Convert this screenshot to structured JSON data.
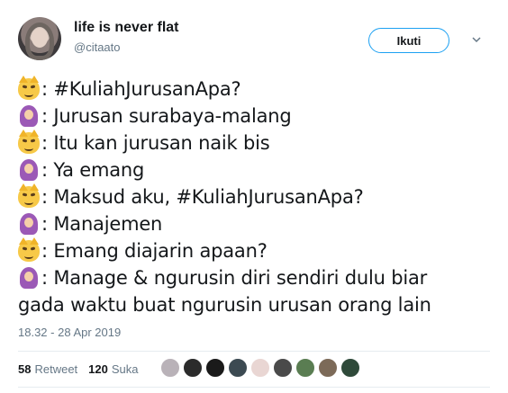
{
  "user": {
    "name": "life is never flat",
    "handle": "@citaato",
    "avatar_icon": "profile-photo"
  },
  "follow_button": {
    "label": "Ikuti"
  },
  "menu_icon": "chevron-down-icon",
  "lines": [
    {
      "speaker": "cat-emoji",
      "text": ": #KuliahJurusanApa?"
    },
    {
      "speaker": "woman-headscarf-emoji",
      "text": ": Jurusan surabaya-malang"
    },
    {
      "speaker": "cat-emoji",
      "text": ": Itu kan jurusan naik bis"
    },
    {
      "speaker": "woman-headscarf-emoji",
      "text": ": Ya emang"
    },
    {
      "speaker": "cat-emoji",
      "text": ": Maksud aku, #KuliahJurusanApa?"
    },
    {
      "speaker": "woman-headscarf-emoji",
      "text": ": Manajemen"
    },
    {
      "speaker": "cat-emoji",
      "text": ": Emang diajarin apaan?"
    },
    {
      "speaker": "woman-headscarf-emoji",
      "text": ": Manage & ngurusin diri sendiri dulu biar"
    },
    {
      "speaker": "",
      "text": "gada waktu buat ngurusin urusan orang lain"
    }
  ],
  "timestamp": "18.32 - 28 Apr 2019",
  "stats": {
    "retweet_count": "58",
    "retweet_label": "Retweet",
    "like_count": "120",
    "like_label": "Suka"
  },
  "likers": [
    {
      "color": "#b9b2b8"
    },
    {
      "color": "#2b2b2b"
    },
    {
      "color": "#1a1a1a"
    },
    {
      "color": "#3c4a52"
    },
    {
      "color": "#e9d6d3"
    },
    {
      "color": "#4a4a4a"
    },
    {
      "color": "#5a7d52"
    },
    {
      "color": "#7c6a58"
    },
    {
      "color": "#2f4a3a"
    }
  ]
}
